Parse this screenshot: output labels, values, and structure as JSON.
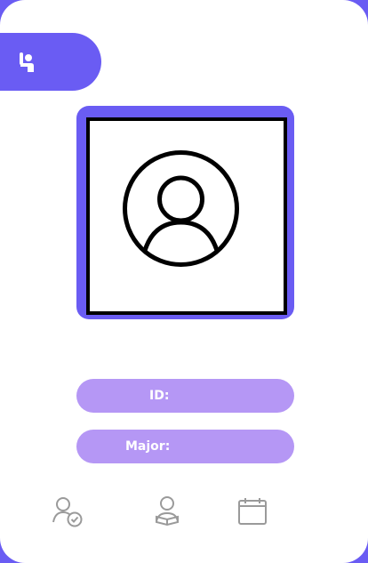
{
  "profile": {
    "id_label": "ID:",
    "major_label": "Major:"
  },
  "icons": {
    "header": "hand-raise-icon",
    "avatar": "user-avatar-icon",
    "nav": [
      "user-check-icon",
      "reader-icon",
      "calendar-icon"
    ]
  },
  "colors": {
    "accent": "#6a5cf3",
    "pill": "#b597f5",
    "icon_gray": "#9a9a9a"
  }
}
